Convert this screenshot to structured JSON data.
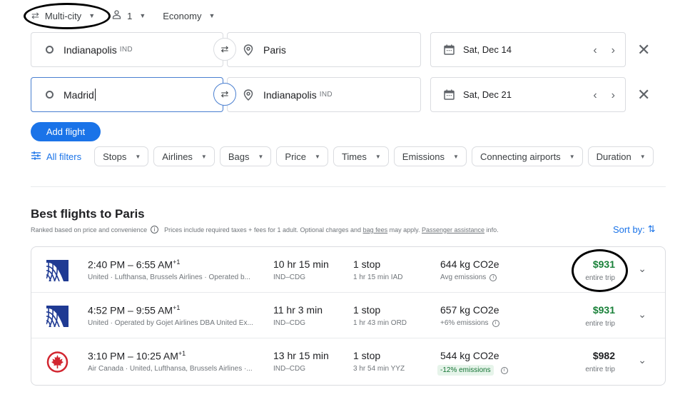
{
  "toolbar": {
    "trip_type": "Multi-city",
    "passengers": "1",
    "cabin_class": "Economy"
  },
  "legs": [
    {
      "origin": "Indianapolis",
      "origin_code": "IND",
      "destination": "Paris",
      "destination_code": "",
      "date": "Sat, Dec 14"
    },
    {
      "origin": "Madrid",
      "origin_code": "",
      "destination": "Indianapolis",
      "destination_code": "IND",
      "date": "Sat, Dec 21"
    }
  ],
  "add_flight_label": "Add flight",
  "filters": {
    "all_filters_label": "All filters",
    "chips": [
      "Stops",
      "Airlines",
      "Bags",
      "Price",
      "Times",
      "Emissions",
      "Connecting airports",
      "Duration"
    ]
  },
  "results": {
    "title": "Best flights to Paris",
    "ranked_text": "Ranked based on price and convenience",
    "prices_text": "Prices include required taxes + fees for 1 adult. Optional charges and",
    "bag_fees_link": "bag fees",
    "may_apply_text": "may apply.",
    "passenger_assistance_link": "Passenger assistance",
    "info_text": "info.",
    "sort_label": "Sort by:"
  },
  "flights": [
    {
      "airline_logo": "united-logo",
      "depart": "2:40 PM",
      "arrive": "6:55 AM",
      "day_offset": "+1",
      "airlines": "United · Lufthansa, Brussels Airlines · Operated b...",
      "duration": "10 hr 15 min",
      "route": "IND–CDG",
      "stops": "1 stop",
      "layover": "1 hr 15 min IAD",
      "co2": "644 kg CO2e",
      "emissions": "Avg emissions",
      "emissions_badge": false,
      "price": "$931",
      "price_color": "#188038",
      "trip_type": "entire trip"
    },
    {
      "airline_logo": "united-logo",
      "depart": "4:52 PM",
      "arrive": "9:55 AM",
      "day_offset": "+1",
      "airlines": "United · Operated by Gojet Airlines DBA United Ex...",
      "duration": "11 hr 3 min",
      "route": "IND–CDG",
      "stops": "1 stop",
      "layover": "1 hr 43 min ORD",
      "co2": "657 kg CO2e",
      "emissions": "+6% emissions",
      "emissions_badge": false,
      "price": "$931",
      "price_color": "#188038",
      "trip_type": "entire trip"
    },
    {
      "airline_logo": "air-canada-logo",
      "depart": "3:10 PM",
      "arrive": "10:25 AM",
      "day_offset": "+1",
      "airlines": "Air Canada · United, Lufthansa, Brussels Airlines ·...",
      "duration": "13 hr 15 min",
      "route": "IND–CDG",
      "stops": "1 stop",
      "layover": "3 hr 54 min YYZ",
      "co2": "544 kg CO2e",
      "emissions": "-12% emissions",
      "emissions_badge": true,
      "price": "$982",
      "price_color": "#202124",
      "trip_type": "entire trip"
    }
  ],
  "colors": {
    "accent": "#1a73e8",
    "price_green": "#188038",
    "eco_badge_bg": "#e6f4ea",
    "united_blue": "#1f3a93",
    "air_canada_red": "#d22630"
  }
}
